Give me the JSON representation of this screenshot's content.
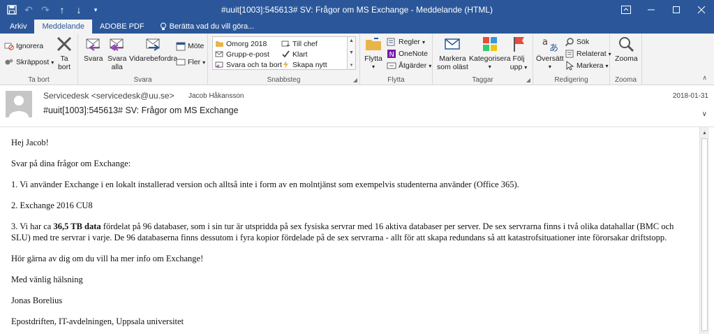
{
  "window": {
    "title": "#uuit[1003]:545613#  SV: Frågor om MS Exchange - Meddelande (HTML)"
  },
  "tabs": {
    "file": "Arkiv",
    "message": "Meddelande",
    "adobe": "ADOBE PDF",
    "tell": "Berätta vad du vill göra..."
  },
  "ribbon": {
    "delete": {
      "label": "Ta bort",
      "ignore": "Ignorera",
      "junk": "Skräppost",
      "delete1": "Ta",
      "delete2": "bort"
    },
    "respond": {
      "label": "Svara",
      "reply": "Svara",
      "replyall1": "Svara",
      "replyall2": "alla",
      "forward": "Vidarebefordra",
      "meeting": "Möte",
      "more": "Fler"
    },
    "quicksteps": {
      "label": "Snabbsteg",
      "items": [
        "Omorg 2018",
        "Till chef",
        "Grupp-e-post",
        "Klart",
        "Svara och ta bort",
        "Skapa nytt"
      ]
    },
    "move": {
      "label": "Flytta",
      "move1": "Flytta",
      "rules": "Regler",
      "onenote": "OneNote",
      "actions": "Åtgärder"
    },
    "tags": {
      "label": "Taggar",
      "mark1": "Markera",
      "mark2": "som oläst",
      "categorize": "Kategorisera",
      "follow1": "Följ",
      "follow2": "upp"
    },
    "editing": {
      "label": "Redigering",
      "translate": "Översätt",
      "find": "Sök",
      "related": "Relaterat",
      "select": "Markera"
    },
    "zoom": {
      "label": "Zooma",
      "zoom": "Zooma"
    }
  },
  "message": {
    "sender": "Servicedesk <servicedesk@uu.se>",
    "recipient": "Jacob Håkansson",
    "date": "2018-01-31",
    "subject": "#uuit[1003]:545613#   SV: Frågor om MS Exchange"
  },
  "body": {
    "greeting": "Hej Jacob!",
    "intro": "Svar på dina frågor om Exchange:",
    "p1": "1. Vi använder Exchange i en lokalt installerad version och alltså inte i form av en molntjänst som exempelvis studenterna använder (Office 365).",
    "p2": "2. Exchange 2016 CU8",
    "p3_pre": "3. Vi har ca ",
    "p3_bold": "36,5 TB data",
    "p3_post": " fördelat på 96 databaser, som i sin tur är utspridda på sex fysiska servrar med 16 aktiva databaser per server. De sex servrarna finns i två olika datahallar (BMC och SLU) med tre servrar i varje. De 96 databaserna finns dessutom i fyra kopior fördelade på de sex servrarna - allt för att skapa redundans så att katastrofsituationer inte förorsakar driftstopp.",
    "p4": "Hör gärna av dig om du vill ha mer info om Exchange!",
    "closing": "Med vänlig hälsning",
    "name": "Jonas Borelius",
    "org": "Epostdriften, IT-avdelningen, Uppsala universitet"
  },
  "colors": {
    "accent": "#2b579a",
    "ribbon": "#f3f3f3"
  }
}
